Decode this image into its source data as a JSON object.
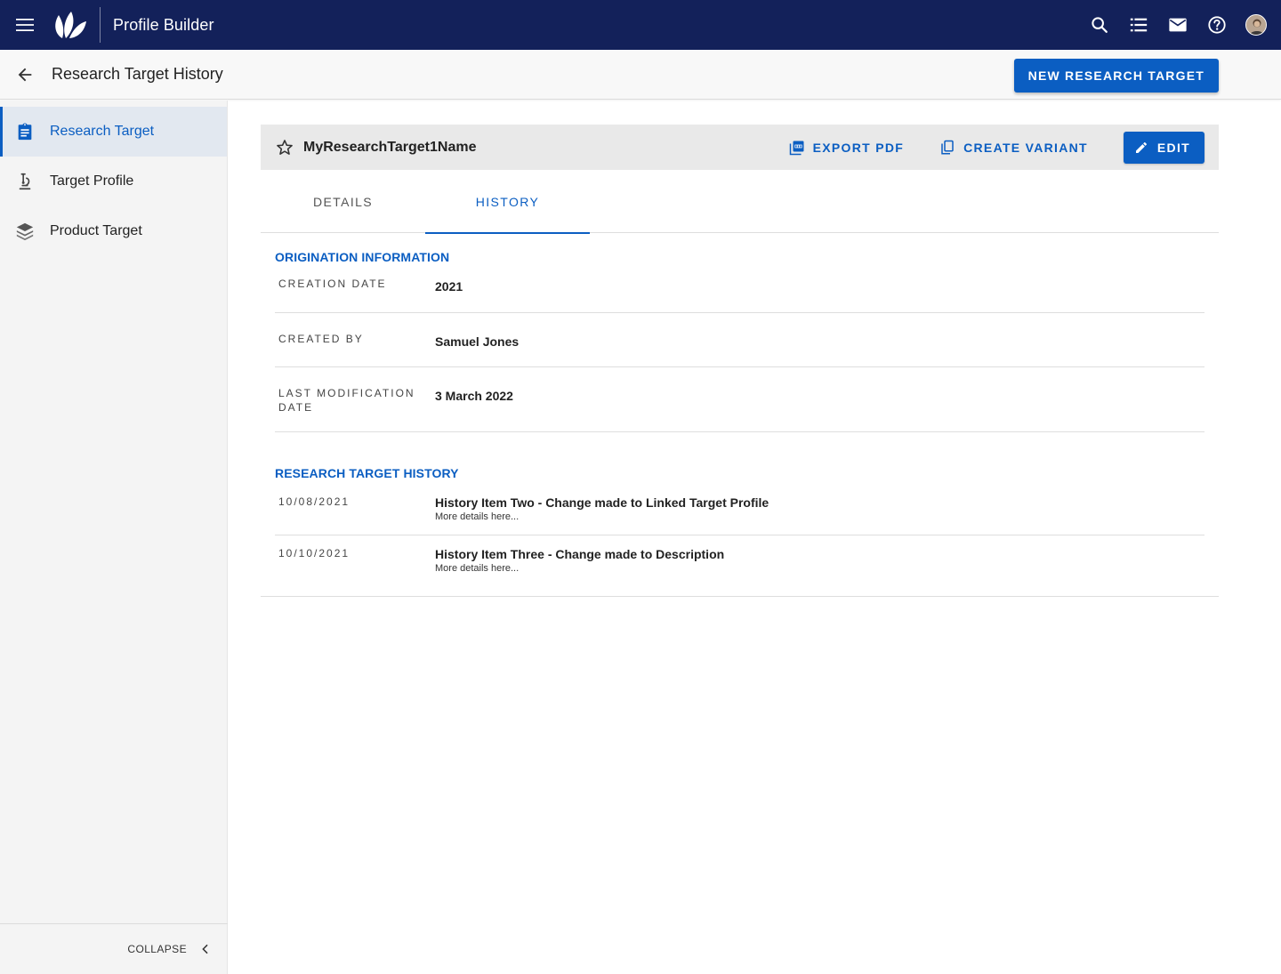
{
  "appbar": {
    "title": "Profile Builder",
    "icons": [
      "menu-icon",
      "leaf-logo-icon",
      "search-icon",
      "list-icon",
      "mail-icon",
      "help-icon",
      "avatar"
    ]
  },
  "subheader": {
    "title": "Research Target History",
    "new_button": "NEW RESEARCH TARGET"
  },
  "sidebar": {
    "items": [
      {
        "label": "Research Target",
        "icon": "clipboard-icon",
        "active": true
      },
      {
        "label": "Target Profile",
        "icon": "microscope-icon",
        "active": false
      },
      {
        "label": "Product Target",
        "icon": "layers-icon",
        "active": false
      }
    ],
    "collapse_label": "COLLAPSE"
  },
  "record": {
    "name": "MyResearchTarget1Name",
    "export_label": "EXPORT PDF",
    "variant_label": "CREATE VARIANT",
    "edit_label": "EDIT"
  },
  "tabs": [
    {
      "label": "DETAILS",
      "active": false
    },
    {
      "label": "HISTORY",
      "active": true
    }
  ],
  "origination": {
    "title": "ORIGINATION INFORMATION",
    "rows": [
      {
        "key": "CREATION DATE",
        "value": "2021"
      },
      {
        "key": "CREATED BY",
        "value": "Samuel Jones"
      },
      {
        "key": "LAST MODIFICATION DATE",
        "value": "3 March 2022"
      }
    ]
  },
  "history": {
    "title": "RESEARCH TARGET HISTORY",
    "items": [
      {
        "date": "10/08/2021",
        "title": "History Item Two - Change made to Linked Target Profile",
        "details": "More details here..."
      },
      {
        "date": "10/10/2021",
        "title": "History Item Three - Change made to Description",
        "details": "More details here..."
      }
    ]
  },
  "colors": {
    "appbar": "#13215a",
    "primary": "#0b5ec2",
    "sidebar_bg": "#f4f4f4",
    "active_nav_bg": "#e2e8f0"
  }
}
